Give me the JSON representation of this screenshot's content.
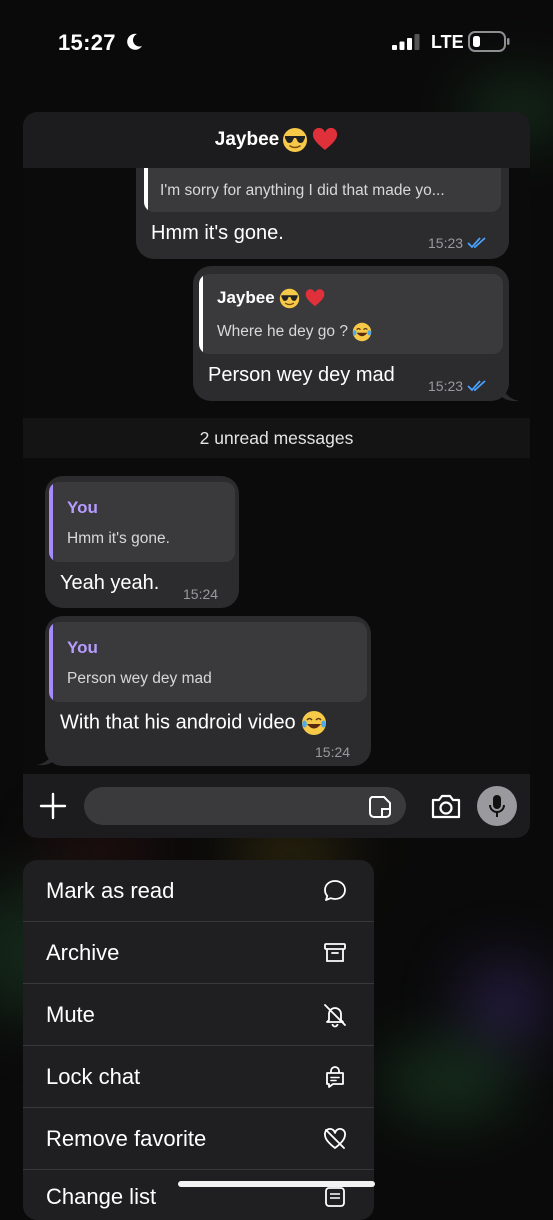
{
  "status_bar": {
    "time": "15:27",
    "network": "LTE"
  },
  "chat": {
    "title": "Jaybee",
    "messages": [
      {
        "direction": "outgoing",
        "quote_text": "I'm sorry for anything I did that made yo...",
        "text": "Hmm it's gone.",
        "time": "15:23",
        "read": true
      },
      {
        "direction": "outgoing",
        "quote_name": "Jaybee",
        "quote_text": "Where he dey go ?",
        "text": "Person wey dey mad",
        "time": "15:23",
        "read": true
      },
      {
        "direction": "incoming",
        "quote_name": "You",
        "quote_text": "Hmm it's gone.",
        "text": "Yeah yeah.",
        "time": "15:24"
      },
      {
        "direction": "incoming",
        "quote_name": "You",
        "quote_text": "Person wey dey mad",
        "text": "With that his android video",
        "time": "15:24"
      }
    ],
    "unread_label": "2 unread messages"
  },
  "context_menu": {
    "items": [
      {
        "label": "Mark as read",
        "icon": "chat-bubble-icon"
      },
      {
        "label": "Archive",
        "icon": "archive-box-icon"
      },
      {
        "label": "Mute",
        "icon": "bell-slash-icon"
      },
      {
        "label": "Lock chat",
        "icon": "lock-chat-icon"
      },
      {
        "label": "Remove favorite",
        "icon": "heart-slash-icon"
      },
      {
        "label": "Change list",
        "icon": "list-icon"
      }
    ]
  },
  "colors": {
    "accent_blue": "#4aa3ff",
    "quote_purple": "#a78bfa",
    "bubble": "#2c2c2e",
    "menu_bg": "#1f1f21"
  }
}
